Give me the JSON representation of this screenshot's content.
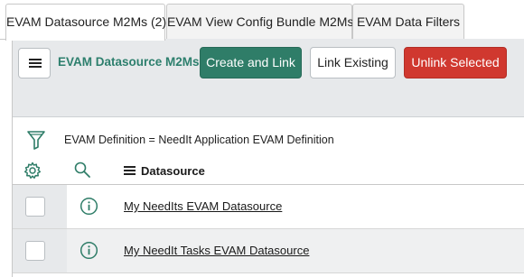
{
  "tabs": [
    {
      "label": "EVAM Datasource M2Ms (2)",
      "active": true
    },
    {
      "label": "EVAM View Config Bundle M2Ms",
      "active": false
    },
    {
      "label": "EVAM Data Filters",
      "active": false
    }
  ],
  "toolbar": {
    "menu_icon": "hamburger-icon",
    "title": "EVAM Datasource M2Ms",
    "create_label": "Create and Link",
    "link_label": "Link Existing",
    "unlink_label": "Unlink Selected"
  },
  "filter": {
    "icon": "filter-icon",
    "text": "EVAM Definition = NeedIt Application EVAM Definition"
  },
  "table": {
    "settings_icon": "gear-icon",
    "search_icon": "search-icon",
    "column_menu_icon": "column-menu-icon",
    "column_header": "Datasource",
    "rows": [
      {
        "info_icon": "info-icon",
        "datasource": "My NeedIts EVAM Datasource"
      },
      {
        "info_icon": "info-icon",
        "datasource": "My NeedIt Tasks EVAM Datasource"
      }
    ]
  },
  "colors": {
    "accent_green": "#2f7d68",
    "title_green": "#2d7f6d",
    "danger_red": "#d0382f",
    "toolbar_bg": "#e7e9eb"
  }
}
